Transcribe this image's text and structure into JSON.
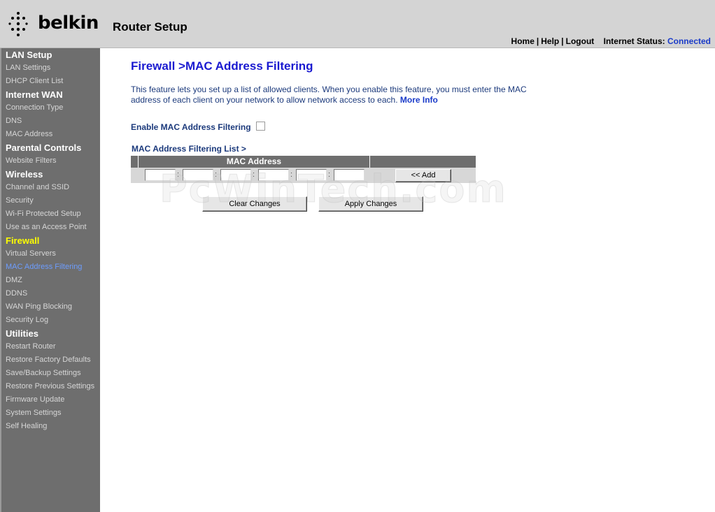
{
  "header": {
    "brand": "belkin",
    "app_title": "Router Setup",
    "nav": {
      "home": "Home",
      "help": "Help",
      "logout": "Logout"
    },
    "separator": "|",
    "status_label": "Internet Status:",
    "status_value": "Connected"
  },
  "sidebar": {
    "sections": [
      {
        "title": "LAN Setup",
        "items": [
          "LAN Settings",
          "DHCP Client List"
        ]
      },
      {
        "title": "Internet WAN",
        "items": [
          "Connection Type",
          "DNS",
          "MAC Address"
        ]
      },
      {
        "title": "Parental Controls",
        "items": [
          "Website Filters"
        ]
      },
      {
        "title": "Wireless",
        "items": [
          "Channel and SSID",
          "Security",
          "Wi-Fi Protected Setup",
          "Use as an Access Point"
        ]
      },
      {
        "title": "Firewall",
        "active": true,
        "items": [
          "Virtual Servers",
          "MAC Address Filtering",
          "DMZ",
          "DDNS",
          "WAN Ping Blocking",
          "Security Log"
        ],
        "active_item": "MAC Address Filtering"
      },
      {
        "title": "Utilities",
        "items": [
          "Restart Router",
          "Restore Factory Defaults",
          "Save/Backup Settings",
          "Restore Previous Settings",
          "Firmware Update",
          "System Settings",
          "Self Healing"
        ]
      }
    ]
  },
  "main": {
    "title": "Firewall >MAC Address Filtering",
    "description": "This feature lets you set up a list of allowed clients. When you enable this feature, you must enter the MAC address of each client on your network to allow network access to each.",
    "more_info": "More Info",
    "enable_label": "Enable MAC Address Filtering",
    "enable_checked": false,
    "list_title": "MAC Address Filtering List >",
    "table_header": "MAC Address",
    "octet_separator": ":",
    "add_label": "<< Add",
    "clear_label": "Clear Changes",
    "apply_label": "Apply Changes"
  },
  "watermark": "PcWinTech.com",
  "colors": {
    "header_bg": "#d4d4d4",
    "sidebar_bg": "#6e6e6e",
    "section_active": "#ffff00",
    "item_active": "#6d9dff",
    "title_blue": "#1a1ad0",
    "text_navy": "#1c3a7c",
    "link_blue": "#1a3bc9"
  }
}
